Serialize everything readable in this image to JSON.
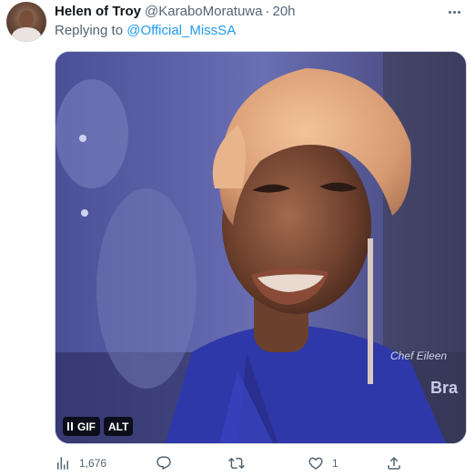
{
  "tweet": {
    "author_name": "Helen of Troy",
    "author_handle": "@KaraboMoratuwa",
    "separator": "·",
    "time": "20h",
    "reply_prefix": "Replying to ",
    "reply_to": "@Official_MissSA"
  },
  "media": {
    "type": "gif",
    "gif_label": "GIF",
    "alt_label": "ALT",
    "overlay_text_1": "Chef Eileen",
    "overlay_text_2": "Bra"
  },
  "actions": {
    "views": "1,676",
    "replies": "",
    "retweets": "",
    "likes": "1"
  },
  "icons": [
    "more-icon",
    "pause-icon",
    "views-icon",
    "reply-icon",
    "retweet-icon",
    "like-icon",
    "share-icon"
  ],
  "colors": {
    "accent": "#1d9bf0",
    "muted": "#536471",
    "text": "#0f1419"
  }
}
